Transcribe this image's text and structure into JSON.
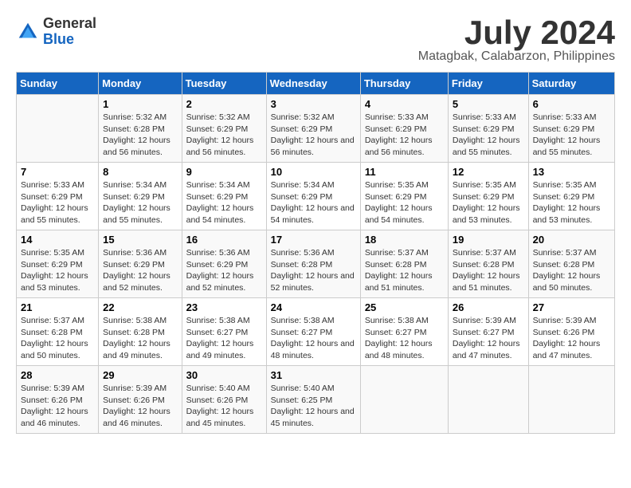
{
  "header": {
    "logo_line1": "General",
    "logo_line2": "Blue",
    "month_year": "July 2024",
    "location": "Matagbak, Calabarzon, Philippines"
  },
  "days_of_week": [
    "Sunday",
    "Monday",
    "Tuesday",
    "Wednesday",
    "Thursday",
    "Friday",
    "Saturday"
  ],
  "weeks": [
    [
      {
        "day": "",
        "sunrise": "",
        "sunset": "",
        "daylight": ""
      },
      {
        "day": "1",
        "sunrise": "Sunrise: 5:32 AM",
        "sunset": "Sunset: 6:28 PM",
        "daylight": "Daylight: 12 hours and 56 minutes."
      },
      {
        "day": "2",
        "sunrise": "Sunrise: 5:32 AM",
        "sunset": "Sunset: 6:29 PM",
        "daylight": "Daylight: 12 hours and 56 minutes."
      },
      {
        "day": "3",
        "sunrise": "Sunrise: 5:32 AM",
        "sunset": "Sunset: 6:29 PM",
        "daylight": "Daylight: 12 hours and 56 minutes."
      },
      {
        "day": "4",
        "sunrise": "Sunrise: 5:33 AM",
        "sunset": "Sunset: 6:29 PM",
        "daylight": "Daylight: 12 hours and 56 minutes."
      },
      {
        "day": "5",
        "sunrise": "Sunrise: 5:33 AM",
        "sunset": "Sunset: 6:29 PM",
        "daylight": "Daylight: 12 hours and 55 minutes."
      },
      {
        "day": "6",
        "sunrise": "Sunrise: 5:33 AM",
        "sunset": "Sunset: 6:29 PM",
        "daylight": "Daylight: 12 hours and 55 minutes."
      }
    ],
    [
      {
        "day": "7",
        "sunrise": "Sunrise: 5:33 AM",
        "sunset": "Sunset: 6:29 PM",
        "daylight": "Daylight: 12 hours and 55 minutes."
      },
      {
        "day": "8",
        "sunrise": "Sunrise: 5:34 AM",
        "sunset": "Sunset: 6:29 PM",
        "daylight": "Daylight: 12 hours and 55 minutes."
      },
      {
        "day": "9",
        "sunrise": "Sunrise: 5:34 AM",
        "sunset": "Sunset: 6:29 PM",
        "daylight": "Daylight: 12 hours and 54 minutes."
      },
      {
        "day": "10",
        "sunrise": "Sunrise: 5:34 AM",
        "sunset": "Sunset: 6:29 PM",
        "daylight": "Daylight: 12 hours and 54 minutes."
      },
      {
        "day": "11",
        "sunrise": "Sunrise: 5:35 AM",
        "sunset": "Sunset: 6:29 PM",
        "daylight": "Daylight: 12 hours and 54 minutes."
      },
      {
        "day": "12",
        "sunrise": "Sunrise: 5:35 AM",
        "sunset": "Sunset: 6:29 PM",
        "daylight": "Daylight: 12 hours and 53 minutes."
      },
      {
        "day": "13",
        "sunrise": "Sunrise: 5:35 AM",
        "sunset": "Sunset: 6:29 PM",
        "daylight": "Daylight: 12 hours and 53 minutes."
      }
    ],
    [
      {
        "day": "14",
        "sunrise": "Sunrise: 5:35 AM",
        "sunset": "Sunset: 6:29 PM",
        "daylight": "Daylight: 12 hours and 53 minutes."
      },
      {
        "day": "15",
        "sunrise": "Sunrise: 5:36 AM",
        "sunset": "Sunset: 6:29 PM",
        "daylight": "Daylight: 12 hours and 52 minutes."
      },
      {
        "day": "16",
        "sunrise": "Sunrise: 5:36 AM",
        "sunset": "Sunset: 6:29 PM",
        "daylight": "Daylight: 12 hours and 52 minutes."
      },
      {
        "day": "17",
        "sunrise": "Sunrise: 5:36 AM",
        "sunset": "Sunset: 6:28 PM",
        "daylight": "Daylight: 12 hours and 52 minutes."
      },
      {
        "day": "18",
        "sunrise": "Sunrise: 5:37 AM",
        "sunset": "Sunset: 6:28 PM",
        "daylight": "Daylight: 12 hours and 51 minutes."
      },
      {
        "day": "19",
        "sunrise": "Sunrise: 5:37 AM",
        "sunset": "Sunset: 6:28 PM",
        "daylight": "Daylight: 12 hours and 51 minutes."
      },
      {
        "day": "20",
        "sunrise": "Sunrise: 5:37 AM",
        "sunset": "Sunset: 6:28 PM",
        "daylight": "Daylight: 12 hours and 50 minutes."
      }
    ],
    [
      {
        "day": "21",
        "sunrise": "Sunrise: 5:37 AM",
        "sunset": "Sunset: 6:28 PM",
        "daylight": "Daylight: 12 hours and 50 minutes."
      },
      {
        "day": "22",
        "sunrise": "Sunrise: 5:38 AM",
        "sunset": "Sunset: 6:28 PM",
        "daylight": "Daylight: 12 hours and 49 minutes."
      },
      {
        "day": "23",
        "sunrise": "Sunrise: 5:38 AM",
        "sunset": "Sunset: 6:27 PM",
        "daylight": "Daylight: 12 hours and 49 minutes."
      },
      {
        "day": "24",
        "sunrise": "Sunrise: 5:38 AM",
        "sunset": "Sunset: 6:27 PM",
        "daylight": "Daylight: 12 hours and 48 minutes."
      },
      {
        "day": "25",
        "sunrise": "Sunrise: 5:38 AM",
        "sunset": "Sunset: 6:27 PM",
        "daylight": "Daylight: 12 hours and 48 minutes."
      },
      {
        "day": "26",
        "sunrise": "Sunrise: 5:39 AM",
        "sunset": "Sunset: 6:27 PM",
        "daylight": "Daylight: 12 hours and 47 minutes."
      },
      {
        "day": "27",
        "sunrise": "Sunrise: 5:39 AM",
        "sunset": "Sunset: 6:26 PM",
        "daylight": "Daylight: 12 hours and 47 minutes."
      }
    ],
    [
      {
        "day": "28",
        "sunrise": "Sunrise: 5:39 AM",
        "sunset": "Sunset: 6:26 PM",
        "daylight": "Daylight: 12 hours and 46 minutes."
      },
      {
        "day": "29",
        "sunrise": "Sunrise: 5:39 AM",
        "sunset": "Sunset: 6:26 PM",
        "daylight": "Daylight: 12 hours and 46 minutes."
      },
      {
        "day": "30",
        "sunrise": "Sunrise: 5:40 AM",
        "sunset": "Sunset: 6:26 PM",
        "daylight": "Daylight: 12 hours and 45 minutes."
      },
      {
        "day": "31",
        "sunrise": "Sunrise: 5:40 AM",
        "sunset": "Sunset: 6:25 PM",
        "daylight": "Daylight: 12 hours and 45 minutes."
      },
      {
        "day": "",
        "sunrise": "",
        "sunset": "",
        "daylight": ""
      },
      {
        "day": "",
        "sunrise": "",
        "sunset": "",
        "daylight": ""
      },
      {
        "day": "",
        "sunrise": "",
        "sunset": "",
        "daylight": ""
      }
    ]
  ]
}
